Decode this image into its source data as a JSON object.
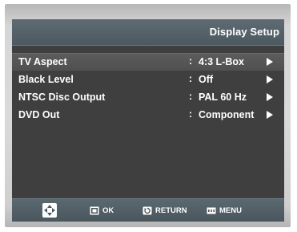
{
  "header": {
    "title": "Display Setup"
  },
  "menu": {
    "items": [
      {
        "label": "TV Aspect",
        "separator": ":",
        "value": "4:3 L-Box",
        "selected": true
      },
      {
        "label": "Black Level",
        "separator": ":",
        "value": "Off",
        "selected": false
      },
      {
        "label": "NTSC Disc Output",
        "separator": ":",
        "value": "PAL 60 Hz",
        "selected": false
      },
      {
        "label": "DVD Out",
        "separator": ":",
        "value": "Component",
        "selected": false
      }
    ]
  },
  "footer": {
    "navigate_icon": "dpad-icon",
    "ok_label": "OK",
    "ok_icon": "enter-icon",
    "return_label": "RETURN",
    "return_icon": "return-icon",
    "menu_label": "MENU",
    "menu_icon": "menu-icon"
  },
  "colors": {
    "screen_bg": "#3f3f3f",
    "header_bg": "#56636a",
    "selected_row_bg": "#555555",
    "text": "#ffffff"
  }
}
